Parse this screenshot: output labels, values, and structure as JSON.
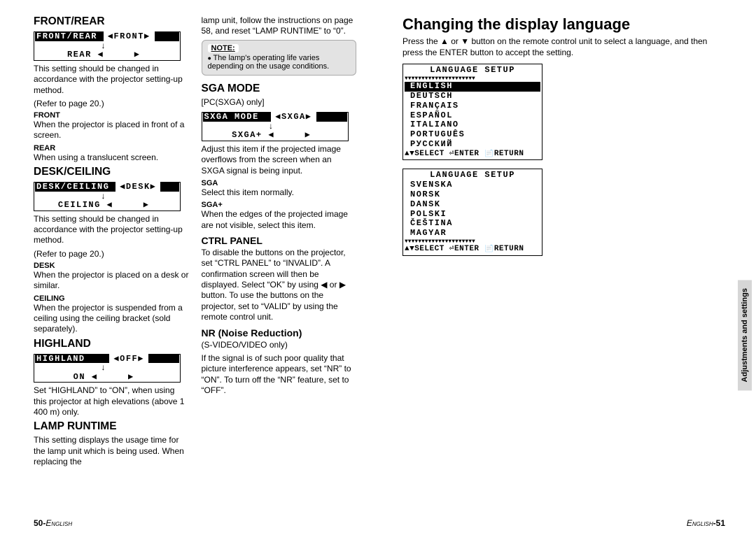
{
  "left": {
    "col1": {
      "sec1": {
        "title": "FRONT/REAR",
        "osd_l": "FRONT/REAR",
        "osd_v": "FRONT",
        "osd2_k": "REAR",
        "p": "This setting should be changed in accordance with the projector setting-up method.",
        "ref": "(Refer to page 20.)",
        "sub1": "FRONT",
        "sub1t": "When the projector is placed in front of a screen.",
        "sub2": "REAR",
        "sub2t": "When using a translucent screen."
      },
      "sec2": {
        "title": "DESK/CEILING",
        "osd_l": "DESK/CEILING",
        "osd_v": "DESK",
        "osd2_k": "CEILING",
        "p": "This setting should be changed in accordance with the projector setting-up method.",
        "ref": "(Refer to page 20.)",
        "sub1": "DESK",
        "sub1t": "When the projector is placed on a desk or similar.",
        "sub2": "CEILING",
        "sub2t": "When the projector is suspended from a ceiling using the ceiling bracket (sold separately)."
      },
      "sec3": {
        "title": "HIGHLAND",
        "osd_l": "HIGHLAND",
        "osd_v": "OFF",
        "osd2_k": "ON",
        "p": "Set “HIGHLAND” to “ON”, when using this projector at high elevations (above 1 400 m) only."
      },
      "sec4": {
        "title": "LAMP RUNTIME",
        "p": "This setting displays the usage time for the lamp unit which is being used. When replacing the"
      }
    },
    "col2": {
      "c1": "lamp unit, follow the instructions on page 58, and reset “LAMP RUNTIME” to “0”.",
      "note_hd": "NOTE:",
      "note": "The lamp's operating life varies depending on the usage conditions.",
      "sec5": {
        "title": "SGA MODE",
        "avail": "[PC(SXGA) only]",
        "osd_l": "SXGA MODE",
        "osd_v": "SXGA",
        "osd2_k": "SXGA+",
        "p": "Adjust this item if the projected image overflows from the screen when an SXGA signal is being input.",
        "sub1": "SGA",
        "sub1t": "Select this item normally.",
        "sub2": "SGA+",
        "sub2t": "When the edges of the projected image are not visible, select this item."
      },
      "sec6": {
        "title": "CTRL PANEL",
        "p": "To disable the buttons on the projector, set “CTRL PANEL” to “INVALID”. A confirmation screen will then be displayed. Select “OK” by using ◀ or ▶ button. To use the buttons on the projector, set to “VALID” by using the remote control unit."
      },
      "sec7": {
        "title": "NR (Noise Reduction)",
        "avail": "(S-VIDEO/VIDEO only)",
        "p": "If the signal is of such poor quality that picture interference appears, set “NR” to “ON”. To turn off the “NR” feature, set to “OFF”."
      }
    },
    "footer_num": "50-",
    "footer_lbl": "English"
  },
  "right": {
    "title": "Changing the display language",
    "intro": "Press the ▲ or ▼ button on the remote control unit to select a language, and then press the ENTER button to accept the setting.",
    "menu1": {
      "title": "LANGUAGE SETUP",
      "items": [
        "ENGLISH",
        "DEUTSCH",
        "FRANÇAIS",
        "ESPAÑOL",
        "ITALIANO",
        "PORTUGUÊS",
        "РУССКИЙ"
      ],
      "sel": 0,
      "footer": "▲▼SELECT  ⏎ENTER  📄RETURN"
    },
    "menu2": {
      "title": "LANGUAGE SETUP",
      "items": [
        "SVENSKA",
        "NORSK",
        "DANSK",
        "POLSKI",
        "ČEŠTINA",
        "MAGYAR"
      ],
      "sel": -1,
      "footer": "▲▼SELECT  ⏎ENTER  📄RETURN"
    },
    "sidetab": "Adjustments and settings",
    "footer_lbl": "English",
    "footer_num": "-51"
  }
}
